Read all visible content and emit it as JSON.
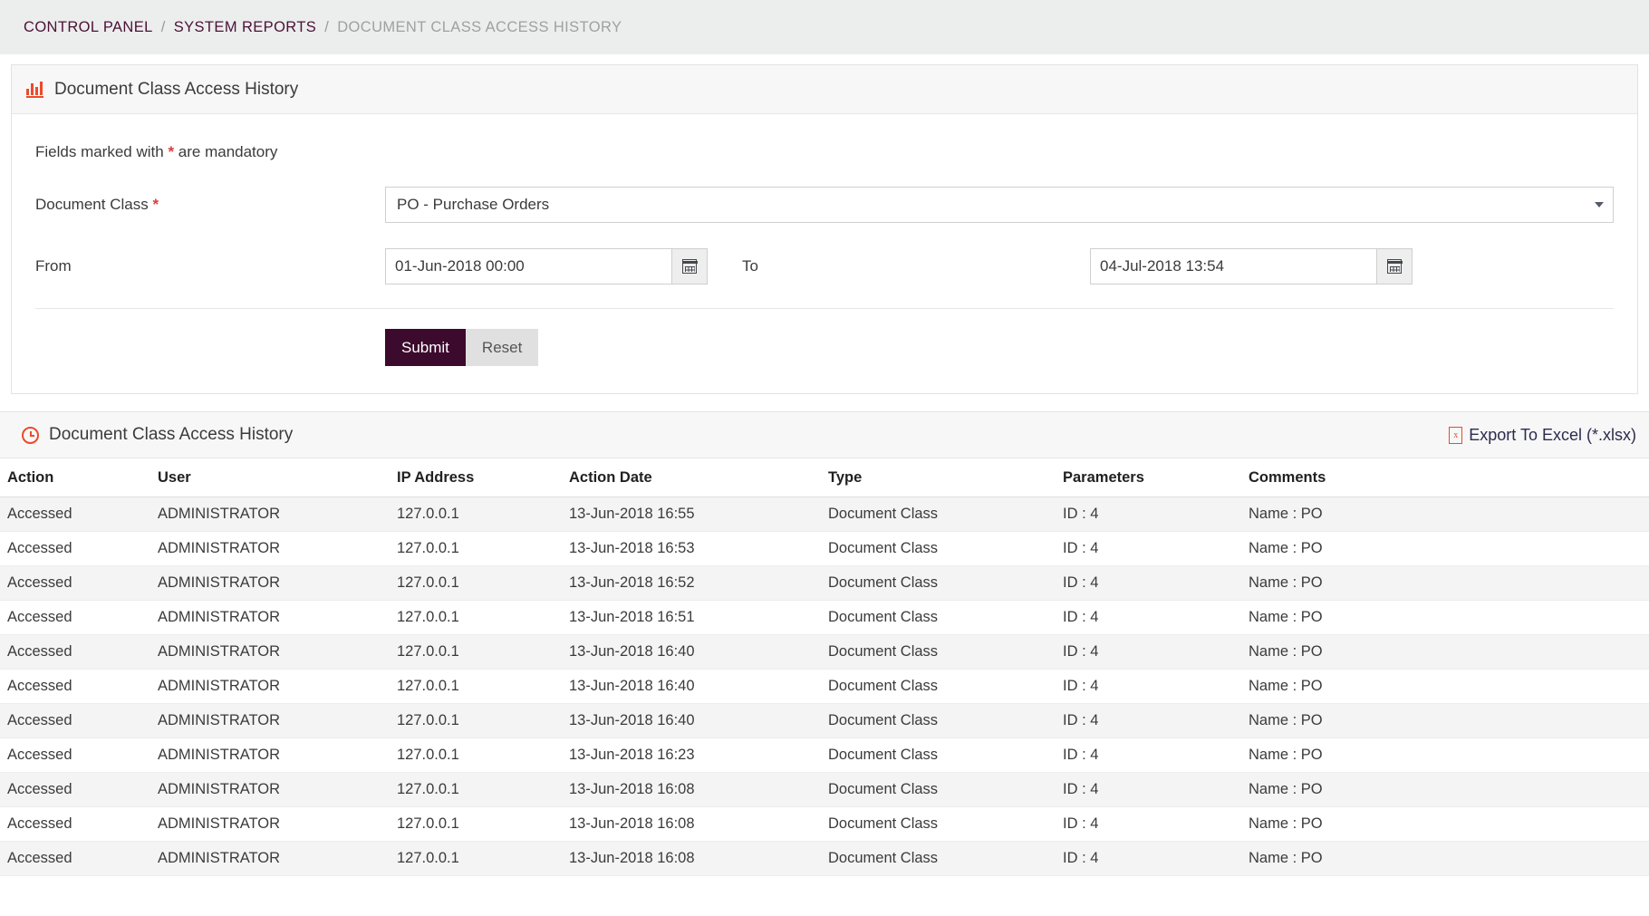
{
  "breadcrumb": {
    "items": [
      {
        "label": "CONTROL PANEL",
        "current": false
      },
      {
        "label": "SYSTEM REPORTS",
        "current": false
      },
      {
        "label": "DOCUMENT CLASS ACCESS HISTORY",
        "current": true
      }
    ],
    "separator": "/"
  },
  "form_panel": {
    "title": "Document Class Access History",
    "icon": "bar-chart-icon",
    "mandatory_note_before": "Fields marked with ",
    "mandatory_note_star": "*",
    "mandatory_note_after": " are mandatory",
    "document_class": {
      "label": "Document Class",
      "required_marker": "*",
      "value": "PO - Purchase Orders",
      "caret_icon": "chevron-down-icon"
    },
    "from": {
      "label": "From",
      "value": "01-Jun-2018 00:00",
      "calendar_icon": "calendar-icon"
    },
    "to": {
      "label": "To",
      "value": "04-Jul-2018 13:54",
      "calendar_icon": "calendar-icon"
    },
    "submit_label": "Submit",
    "reset_label": "Reset"
  },
  "results_panel": {
    "title": "Document Class Access History",
    "icon": "clock-icon",
    "export_label": "Export To Excel (*.xlsx)",
    "export_icon": "excel-file-icon",
    "columns": [
      "Action",
      "User",
      "IP Address",
      "Action Date",
      "Type",
      "Parameters",
      "Comments"
    ],
    "rows": [
      [
        "Accessed",
        "ADMINISTRATOR",
        "127.0.0.1",
        "13-Jun-2018 16:55",
        "Document Class",
        "ID : 4",
        "Name : PO"
      ],
      [
        "Accessed",
        "ADMINISTRATOR",
        "127.0.0.1",
        "13-Jun-2018 16:53",
        "Document Class",
        "ID : 4",
        "Name : PO"
      ],
      [
        "Accessed",
        "ADMINISTRATOR",
        "127.0.0.1",
        "13-Jun-2018 16:52",
        "Document Class",
        "ID : 4",
        "Name : PO"
      ],
      [
        "Accessed",
        "ADMINISTRATOR",
        "127.0.0.1",
        "13-Jun-2018 16:51",
        "Document Class",
        "ID : 4",
        "Name : PO"
      ],
      [
        "Accessed",
        "ADMINISTRATOR",
        "127.0.0.1",
        "13-Jun-2018 16:40",
        "Document Class",
        "ID : 4",
        "Name : PO"
      ],
      [
        "Accessed",
        "ADMINISTRATOR",
        "127.0.0.1",
        "13-Jun-2018 16:40",
        "Document Class",
        "ID : 4",
        "Name : PO"
      ],
      [
        "Accessed",
        "ADMINISTRATOR",
        "127.0.0.1",
        "13-Jun-2018 16:40",
        "Document Class",
        "ID : 4",
        "Name : PO"
      ],
      [
        "Accessed",
        "ADMINISTRATOR",
        "127.0.0.1",
        "13-Jun-2018 16:23",
        "Document Class",
        "ID : 4",
        "Name : PO"
      ],
      [
        "Accessed",
        "ADMINISTRATOR",
        "127.0.0.1",
        "13-Jun-2018 16:08",
        "Document Class",
        "ID : 4",
        "Name : PO"
      ],
      [
        "Accessed",
        "ADMINISTRATOR",
        "127.0.0.1",
        "13-Jun-2018 16:08",
        "Document Class",
        "ID : 4",
        "Name : PO"
      ],
      [
        "Accessed",
        "ADMINISTRATOR",
        "127.0.0.1",
        "13-Jun-2018 16:08",
        "Document Class",
        "ID : 4",
        "Name : PO"
      ]
    ]
  },
  "colors": {
    "breadcrumb_link": "#4a1236",
    "breadcrumb_current": "#a0a0a0",
    "accent_icon": "#eb4b2a",
    "submit_button": "#3c0a2c",
    "required_star": "#e03b3b",
    "row_alt": "#f4f4f4"
  }
}
